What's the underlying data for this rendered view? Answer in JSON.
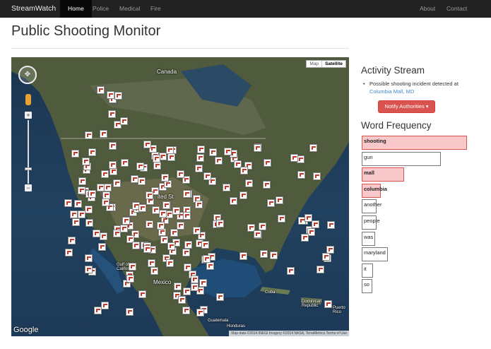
{
  "navbar": {
    "brand": "StreamWatch",
    "items": [
      "Home",
      "Police",
      "Medical",
      "Fire"
    ],
    "right_items": [
      "About",
      "Contact"
    ]
  },
  "page_title": "Public Shooting Monitor",
  "map": {
    "type_buttons": [
      "Map",
      "Satellite"
    ],
    "labels": {
      "canada": "Canada",
      "united_states": "ited St",
      "gulf": "Gulf of\nCalifornia",
      "mexico": "Mexico",
      "cuba": "Cuba",
      "dominican": "Dominican\nRepublic",
      "guatemala": "Guatemala",
      "honduras": "Honduras",
      "puerto_rico": "Puerto\nRico"
    },
    "logo": "Google",
    "attribution": "Map data ©2014 INEGI Imagery ©2014 NASA, TerraMetrics   Terms of Use",
    "marker_count": 190
  },
  "activity": {
    "heading": "Activity Stream",
    "item_text": "Possible shooting incident detected at ",
    "item_link": "Columbia Mall, MD",
    "button": "Notify Authorities ▾"
  },
  "word_frequency": {
    "heading": "Word Frequency",
    "words": [
      {
        "word": "shooting",
        "value": 1.0,
        "highlight": true
      },
      {
        "word": "gun",
        "value": 0.755,
        "highlight": false
      },
      {
        "word": "mall",
        "value": 0.4,
        "highlight": true
      },
      {
        "word": "columbia",
        "value": 0.18,
        "highlight": true
      },
      {
        "word": "another",
        "value": 0.14,
        "highlight": false
      },
      {
        "word": "people",
        "value": 0.14,
        "highlight": false
      },
      {
        "word": "was",
        "value": 0.125,
        "highlight": false
      },
      {
        "word": "maryland",
        "value": 0.25,
        "highlight": false
      },
      {
        "word": "it",
        "value": 0.11,
        "highlight": false
      },
      {
        "word": "so",
        "value": 0.1,
        "highlight": false
      }
    ]
  },
  "colors": {
    "navbar_bg": "#222222",
    "accent_red": "#d9534f",
    "highlight_fill": "#f9c8ca",
    "link": "#428bca"
  }
}
